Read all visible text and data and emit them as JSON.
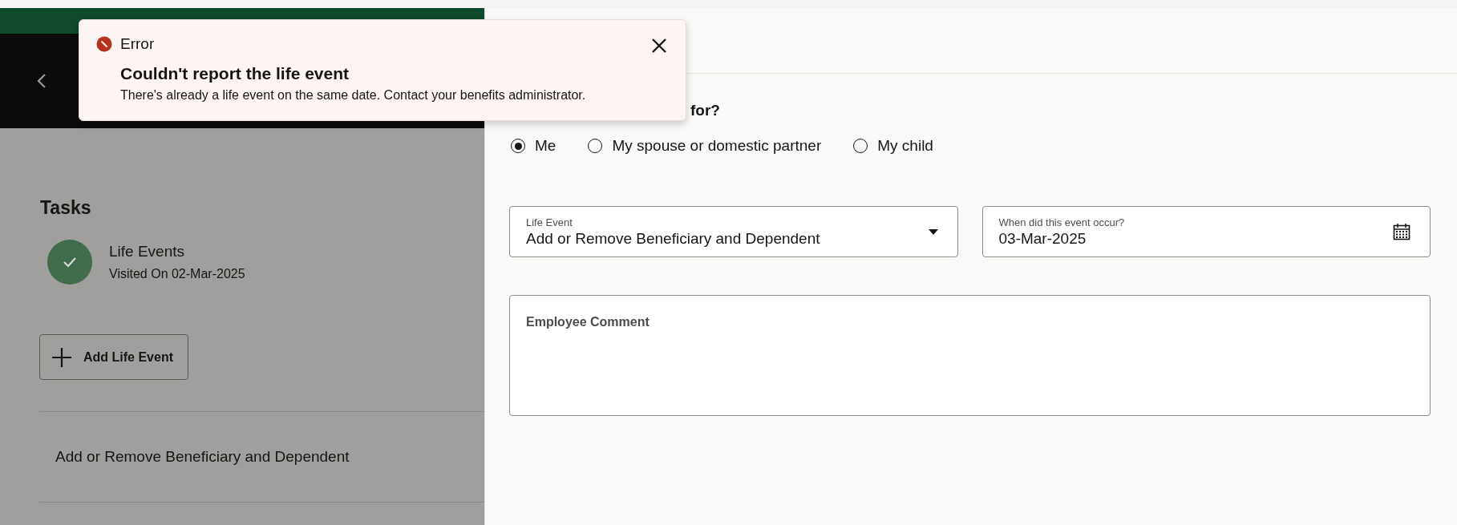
{
  "tasks": {
    "title": "Tasks",
    "items": [
      {
        "name": "Life Events",
        "detail": "Visited On 02-Mar-2025",
        "completed": true
      }
    ],
    "add_button": "Add Life Event",
    "events": [
      "Add or Remove Beneficiary and Dependent"
    ]
  },
  "form": {
    "question": "for?",
    "radios": [
      {
        "label": "Me",
        "selected": true
      },
      {
        "label": "My spouse or domestic partner",
        "selected": false
      },
      {
        "label": "My child",
        "selected": false
      }
    ],
    "life_event": {
      "label": "Life Event",
      "value": "Add or Remove Beneficiary and Dependent"
    },
    "event_date": {
      "label": "When did this event occur?",
      "value": "03-Mar-2025"
    },
    "comment": {
      "label": "Employee Comment"
    }
  },
  "toast": {
    "severity": "Error",
    "title": "Couldn't report the life event",
    "message": "There's already a life event on the same date. Contact your benefits administrator."
  }
}
